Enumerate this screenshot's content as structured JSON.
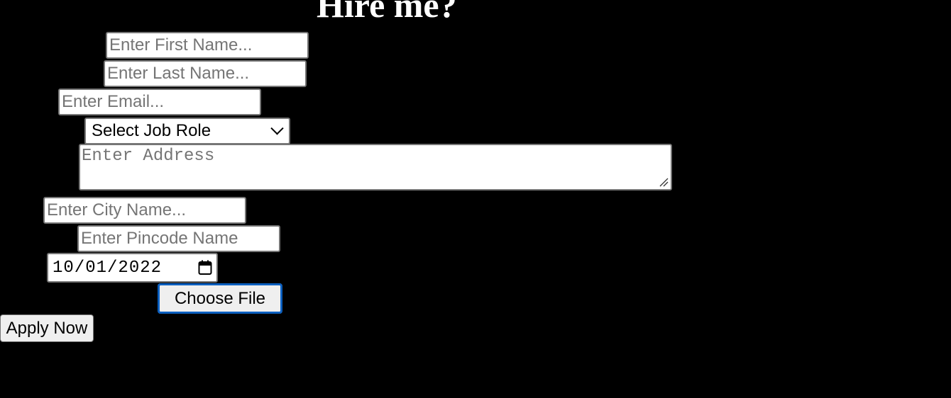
{
  "header": {
    "title": "Hire me?"
  },
  "form": {
    "first_name": {
      "placeholder": "Enter First Name...",
      "value": ""
    },
    "last_name": {
      "placeholder": "Enter Last Name...",
      "value": ""
    },
    "email": {
      "placeholder": "Enter Email...",
      "value": ""
    },
    "job_role": {
      "selected": "Select Job Role",
      "icon": "chevron-down-icon"
    },
    "address": {
      "placeholder": "Enter Address",
      "value": ""
    },
    "city": {
      "placeholder": "Enter City Name...",
      "value": ""
    },
    "pincode": {
      "placeholder": "Enter Pincode Name",
      "value": ""
    },
    "date": {
      "value": "10/01/2022",
      "icon": "calendar-icon"
    },
    "file_button_label": "Choose File",
    "submit_label": "Apply Now"
  },
  "colors": {
    "page_background": "#000000",
    "title_text": "#ffffff",
    "field_border": "#767676",
    "placeholder_text": "#757575",
    "button_background": "#efefef",
    "focus_ring": "#0b5fbf"
  }
}
